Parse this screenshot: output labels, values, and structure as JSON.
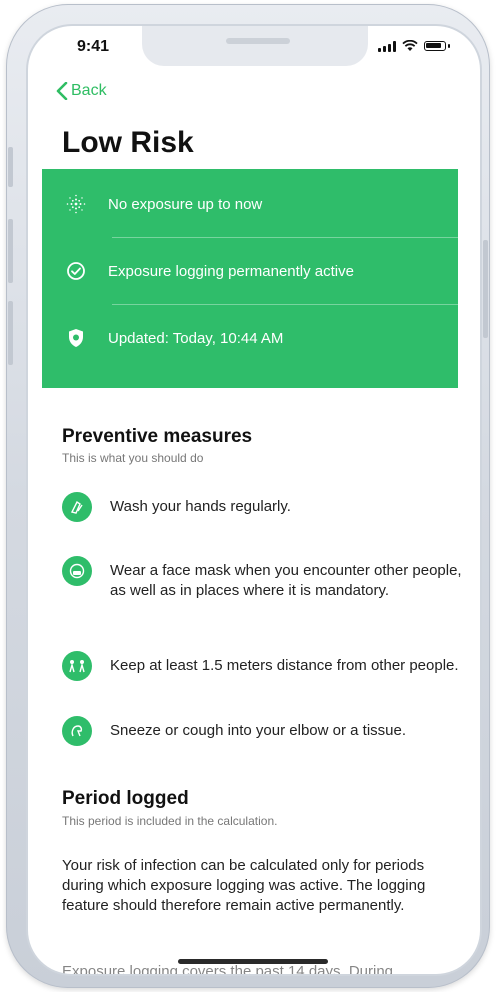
{
  "status_bar": {
    "time": "9:41"
  },
  "nav": {
    "back_label": "Back"
  },
  "page": {
    "title": "Low Risk"
  },
  "risk_panel": {
    "color": "#2fbd6a",
    "rows": [
      {
        "icon": "virus-scan-icon",
        "label": "No exposure up to now"
      },
      {
        "icon": "check-circle-icon",
        "label": "Exposure logging permanently active"
      },
      {
        "icon": "shield-icon",
        "label": "Updated: Today, 10:44 AM"
      }
    ]
  },
  "preventive": {
    "title": "Preventive measures",
    "subtitle": "This is what you should do",
    "items": [
      {
        "icon": "hand-wash-icon",
        "text": "Wash your hands regularly."
      },
      {
        "icon": "face-mask-icon",
        "text": "Wear a face mask when you encounter other people, as well as in places where it is mandatory."
      },
      {
        "icon": "distance-icon",
        "text": "Keep at least 1.5 meters distance from other people."
      },
      {
        "icon": "sneeze-icon",
        "text": "Sneeze or cough into your elbow or a tissue."
      }
    ]
  },
  "period": {
    "title": "Period logged",
    "subtitle": "This period is included in the calculation.",
    "body": "Your risk of infection can be calculated only for periods during which exposure logging was active. The logging feature should therefore remain active permanently.",
    "cut_off": "Exposure logging covers the past 14 days. During"
  }
}
